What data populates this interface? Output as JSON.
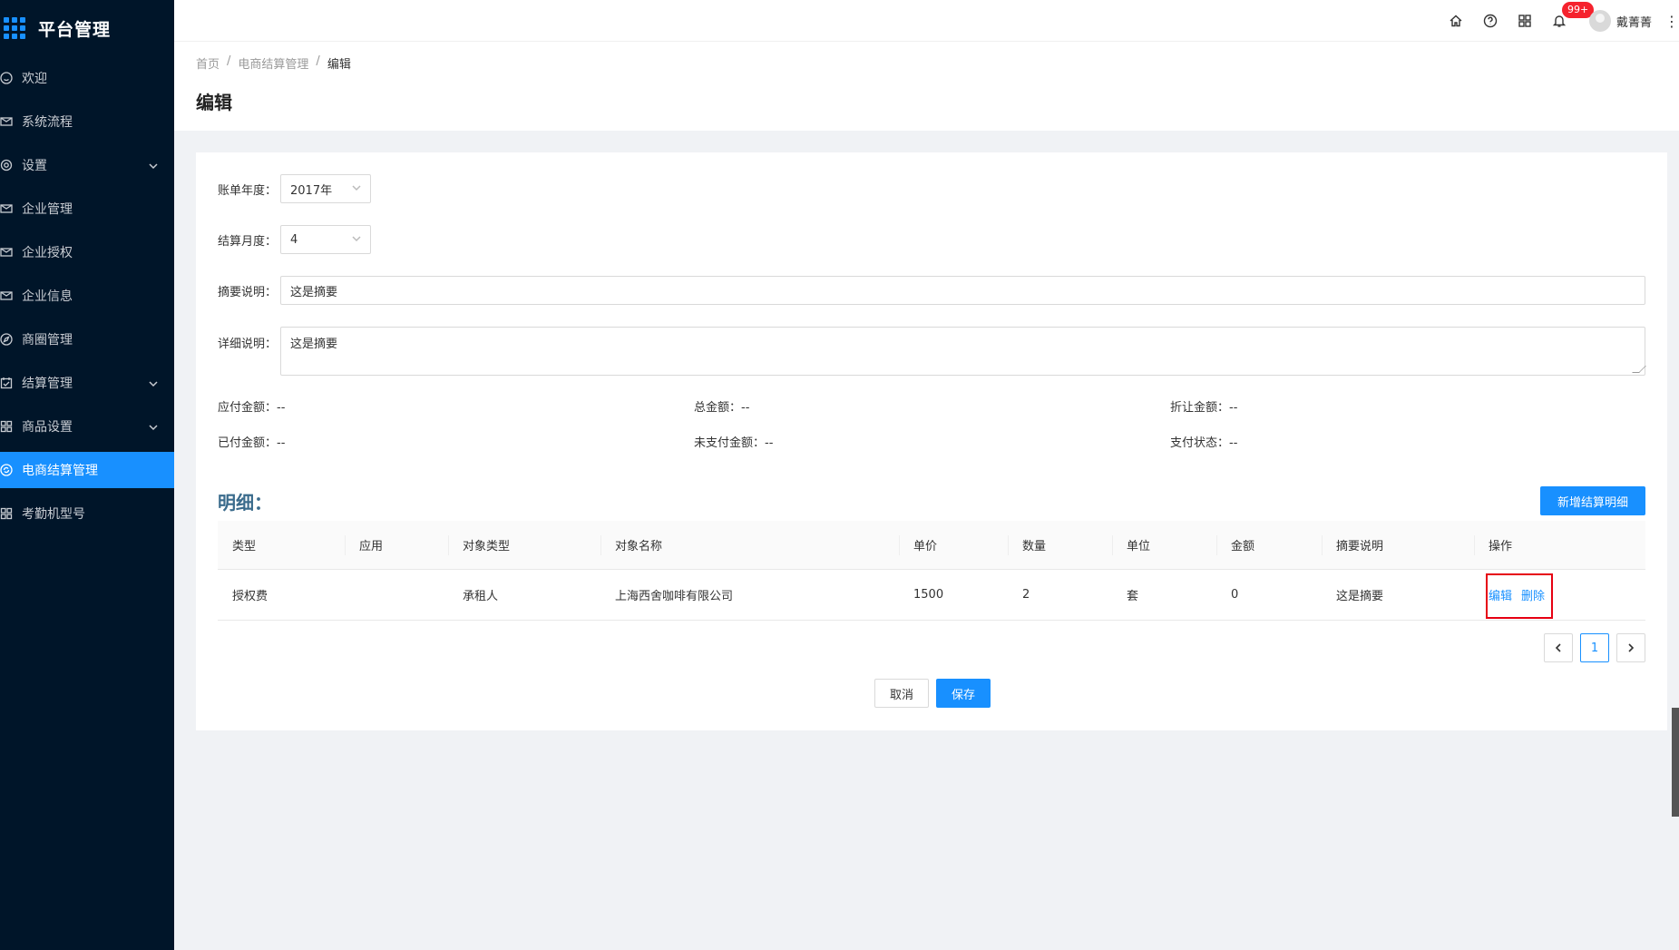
{
  "app": {
    "title": "平台管理"
  },
  "sidebar": {
    "items": [
      {
        "label": "欢迎",
        "icon": "smile-icon",
        "caret": false,
        "active": false
      },
      {
        "label": "系统流程",
        "icon": "mail-icon",
        "caret": false,
        "active": false
      },
      {
        "label": "设置",
        "icon": "gear-icon",
        "caret": true,
        "active": false
      },
      {
        "label": "企业管理",
        "icon": "mail-icon",
        "caret": false,
        "active": false
      },
      {
        "label": "企业授权",
        "icon": "mail-icon",
        "caret": false,
        "active": false
      },
      {
        "label": "企业信息",
        "icon": "mail-icon",
        "caret": false,
        "active": false
      },
      {
        "label": "商圈管理",
        "icon": "compass-icon",
        "caret": false,
        "active": false
      },
      {
        "label": "结算管理",
        "icon": "calendar-icon",
        "caret": true,
        "active": false
      },
      {
        "label": "商品设置",
        "icon": "grid-icon",
        "caret": true,
        "active": false
      },
      {
        "label": "电商结算管理",
        "icon": "sync-icon",
        "caret": false,
        "active": true
      },
      {
        "label": "考勤机型号",
        "icon": "grid-icon",
        "caret": false,
        "active": false
      }
    ]
  },
  "header": {
    "notifications_badge": "99+",
    "user_name": "戴菁菁",
    "more": "⋮"
  },
  "breadcrumb": {
    "items": [
      "首页",
      "电商结算管理"
    ],
    "separator": "/",
    "current": "编辑"
  },
  "page": {
    "title": "编辑"
  },
  "form": {
    "year_label": "账单年度：",
    "year_value": "2017年",
    "month_label": "结算月度：",
    "month_value": "4",
    "summary_label": "摘要说明：",
    "summary_value": "这是摘要",
    "detail_label": "详细说明：",
    "detail_value": "这是摘要"
  },
  "info": {
    "payable": "应付金额：--",
    "total": "总金额：--",
    "discount": "折让金额：--",
    "paid": "已付金额：--",
    "unpaid": "未支付金额：--",
    "pay_status": "支付状态：--"
  },
  "detail": {
    "title": "明细：",
    "add_button": "新增结算明细",
    "columns": [
      "类型",
      "应用",
      "对象类型",
      "对象名称",
      "单价",
      "数量",
      "单位",
      "金额",
      "摘要说明",
      "操作"
    ],
    "rows": [
      {
        "type": "授权费",
        "app": "",
        "object_type": "承租人",
        "object_name": "上海西舍咖啡有限公司",
        "price": "1500",
        "qty": "2",
        "unit": "套",
        "amount": "0",
        "summary": "这是摘要",
        "edit": "编辑",
        "delete": "删除"
      }
    ]
  },
  "pagination": {
    "current": "1"
  },
  "actions": {
    "cancel": "取消",
    "save": "保存"
  },
  "colors": {
    "sidebar_bg": "#001529",
    "primary": "#1890ff",
    "highlight": "#e60012"
  }
}
